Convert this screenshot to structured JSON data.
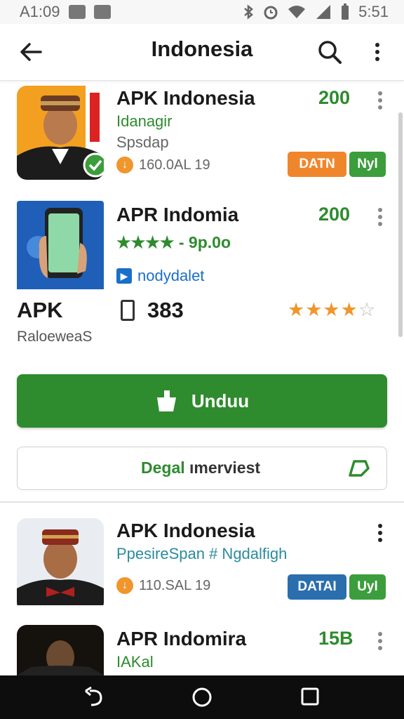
{
  "status_bar": {
    "carrier": "A1:09",
    "time": "5:51"
  },
  "app_bar": {
    "title": "Indonesia"
  },
  "items": [
    {
      "name": "APK Indonesia",
      "count": "200",
      "subtitle": "Idanagir",
      "line3": "Spsdap",
      "meta": "160.0AL 19",
      "badges": [
        "DATN",
        "Nyl"
      ]
    },
    {
      "name": "APR Indomia",
      "count": "200",
      "rating_text": "★★★★ - 9p.0o",
      "dev": "nodydalet"
    },
    {
      "name": "APK Indonesia",
      "subtitle": "PpesireSpan # Ngdalfigh",
      "meta": "110.SAL 19",
      "badges": [
        "DATAI",
        "Uyl"
      ]
    },
    {
      "name": "APR Indomira",
      "count": "15B",
      "subtitle": "IAKal"
    }
  ],
  "stats": {
    "label": "APK",
    "sublabel": "RaloeweaS",
    "downloads": "383",
    "rating": 4
  },
  "buttons": {
    "primary": "Unduu",
    "secondary_a": "Degal",
    "secondary_b": "ımerviest"
  },
  "colors": {
    "accent_green": "#2e8b2e",
    "orange": "#f0962c",
    "blue_badge": "#2a6ead",
    "teal_text": "#2a8c9c"
  }
}
